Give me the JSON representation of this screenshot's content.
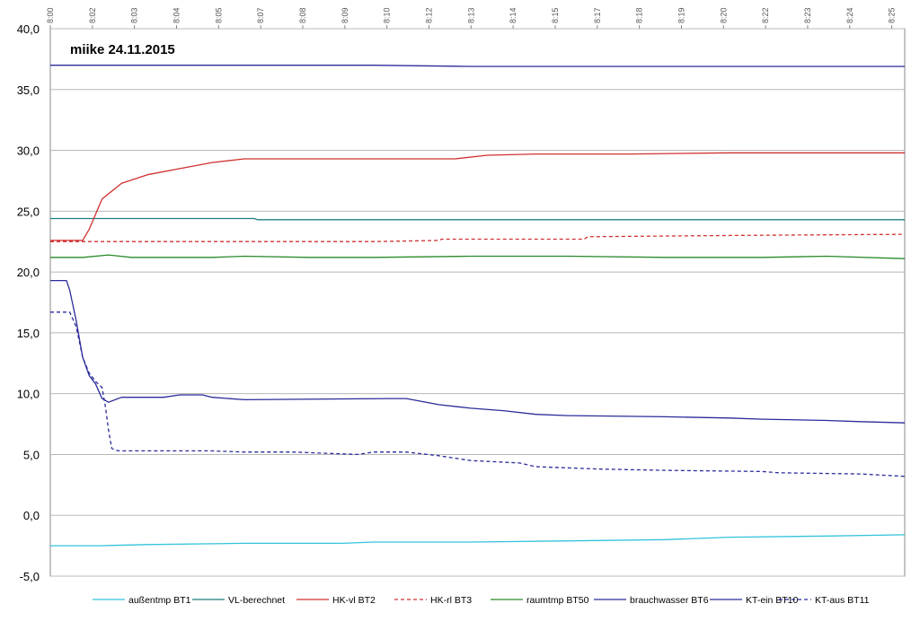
{
  "chart_data": {
    "type": "line",
    "title": "miike 24.11.2015",
    "ylim": [
      -5,
      40
    ],
    "yticks": [
      "40,0",
      "35,0",
      "30,0",
      "25,0",
      "20,0",
      "15,0",
      "10,0",
      "5,0",
      "0,0",
      "-5,0"
    ],
    "ytick_values": [
      40,
      35,
      30,
      25,
      20,
      15,
      10,
      5,
      0,
      -5
    ],
    "grid": true,
    "legend_position": "bottom",
    "x_minutes_range": [
      0,
      26.4
    ],
    "x_tick_labels": [
      "8:00",
      "8:02",
      "8:03",
      "8:04",
      "8:05",
      "8:07",
      "8:08",
      "8:09",
      "8:10",
      "8:12",
      "8:13",
      "8:14",
      "8:15",
      "8:17",
      "8:18",
      "8:19",
      "8:20",
      "8:22",
      "8:23",
      "8:24",
      "8:25"
    ],
    "x_tick_minutes": [
      0,
      1.3,
      2.6,
      3.9,
      5.2,
      6.5,
      7.8,
      9.1,
      10.4,
      11.7,
      13,
      14.3,
      15.6,
      16.9,
      18.2,
      19.5,
      20.8,
      22.1,
      23.4,
      24.7,
      26
    ],
    "series": [
      {
        "name": "außentmp BT1",
        "color": "#33c3dd",
        "dash": "solid",
        "points": [
          [
            0,
            -2.5
          ],
          [
            1.5,
            -2.5
          ],
          [
            3,
            -2.4
          ],
          [
            6,
            -2.3
          ],
          [
            9,
            -2.3
          ],
          [
            10,
            -2.2
          ],
          [
            13,
            -2.2
          ],
          [
            16,
            -2.1
          ],
          [
            19,
            -2.0
          ],
          [
            21,
            -1.8
          ],
          [
            24,
            -1.7
          ],
          [
            26.4,
            -1.6
          ]
        ]
      },
      {
        "name": "VL-berechnet",
        "color": "#1f7f7f",
        "dash": "solid",
        "points": [
          [
            0,
            24.4
          ],
          [
            6.3,
            24.4
          ],
          [
            6.4,
            24.3
          ],
          [
            26.4,
            24.3
          ]
        ]
      },
      {
        "name": "HK-vl BT2",
        "color": "#d03030",
        "dash": "solid",
        "points": [
          [
            0,
            22.6
          ],
          [
            1.0,
            22.6
          ],
          [
            1.2,
            23.5
          ],
          [
            1.6,
            26
          ],
          [
            2.2,
            27.3
          ],
          [
            3,
            28
          ],
          [
            4,
            28.5
          ],
          [
            5,
            29
          ],
          [
            6,
            29.3
          ],
          [
            7,
            29.3
          ],
          [
            12.5,
            29.3
          ],
          [
            13.5,
            29.6
          ],
          [
            15,
            29.7
          ],
          [
            18,
            29.7
          ],
          [
            21,
            29.8
          ],
          [
            26.4,
            29.8
          ]
        ]
      },
      {
        "name": "HK-rl BT3",
        "color": "#d03030",
        "dash": "dashed",
        "points": [
          [
            0,
            22.5
          ],
          [
            6,
            22.5
          ],
          [
            10,
            22.5
          ],
          [
            12,
            22.6
          ],
          [
            12.1,
            22.7
          ],
          [
            16.5,
            22.7
          ],
          [
            16.6,
            22.9
          ],
          [
            21,
            23.0
          ],
          [
            26.4,
            23.1
          ]
        ]
      },
      {
        "name": "raumtmp BT50",
        "color": "#2a8a2a",
        "dash": "solid",
        "points": [
          [
            0,
            21.2
          ],
          [
            1,
            21.2
          ],
          [
            1.8,
            21.4
          ],
          [
            2.5,
            21.2
          ],
          [
            5,
            21.2
          ],
          [
            6,
            21.3
          ],
          [
            8,
            21.2
          ],
          [
            10,
            21.2
          ],
          [
            13,
            21.3
          ],
          [
            16,
            21.3
          ],
          [
            19,
            21.2
          ],
          [
            22,
            21.2
          ],
          [
            24,
            21.3
          ],
          [
            26.4,
            21.1
          ]
        ]
      },
      {
        "name": "brauchwasser BT6",
        "color": "#2b2b9a",
        "dash": "solid",
        "points": [
          [
            0,
            37
          ],
          [
            10,
            37
          ],
          [
            13,
            36.9
          ],
          [
            26.4,
            36.9
          ]
        ]
      },
      {
        "name": "KT-ein BT10",
        "color": "#2b2b9a",
        "dash": "solid",
        "points": [
          [
            0,
            19.3
          ],
          [
            0.5,
            19.3
          ],
          [
            0.6,
            18.5
          ],
          [
            0.8,
            16
          ],
          [
            1.0,
            13
          ],
          [
            1.2,
            11.5
          ],
          [
            1.4,
            10.8
          ],
          [
            1.6,
            9.6
          ],
          [
            1.8,
            9.3
          ],
          [
            2.2,
            9.7
          ],
          [
            3.5,
            9.7
          ],
          [
            4,
            9.9
          ],
          [
            4.7,
            9.9
          ],
          [
            5,
            9.7
          ],
          [
            6,
            9.5
          ],
          [
            10.5,
            9.6
          ],
          [
            11,
            9.6
          ],
          [
            12,
            9.1
          ],
          [
            13,
            8.8
          ],
          [
            14,
            8.6
          ],
          [
            15,
            8.3
          ],
          [
            16,
            8.2
          ],
          [
            19,
            8.1
          ],
          [
            21,
            8.0
          ],
          [
            22,
            7.9
          ],
          [
            24,
            7.8
          ],
          [
            25,
            7.7
          ],
          [
            26.4,
            7.6
          ]
        ]
      },
      {
        "name": "KT-aus BT11",
        "color": "#2b2b9a",
        "dash": "dashed",
        "points": [
          [
            0,
            16.7
          ],
          [
            0.6,
            16.7
          ],
          [
            0.8,
            15.5
          ],
          [
            1.0,
            13
          ],
          [
            1.2,
            11.7
          ],
          [
            1.4,
            11.0
          ],
          [
            1.6,
            10.5
          ],
          [
            1.7,
            9.0
          ],
          [
            1.8,
            7.0
          ],
          [
            1.9,
            5.5
          ],
          [
            2.1,
            5.3
          ],
          [
            3,
            5.3
          ],
          [
            5,
            5.3
          ],
          [
            6,
            5.2
          ],
          [
            7.5,
            5.2
          ],
          [
            8.5,
            5.1
          ],
          [
            9.5,
            5.0
          ],
          [
            10,
            5.2
          ],
          [
            11,
            5.2
          ],
          [
            12,
            4.9
          ],
          [
            13,
            4.5
          ],
          [
            14.5,
            4.3
          ],
          [
            15,
            4.0
          ],
          [
            17,
            3.8
          ],
          [
            19,
            3.7
          ],
          [
            22,
            3.6
          ],
          [
            22.5,
            3.5
          ],
          [
            25,
            3.4
          ],
          [
            26.4,
            3.2
          ]
        ]
      }
    ]
  }
}
